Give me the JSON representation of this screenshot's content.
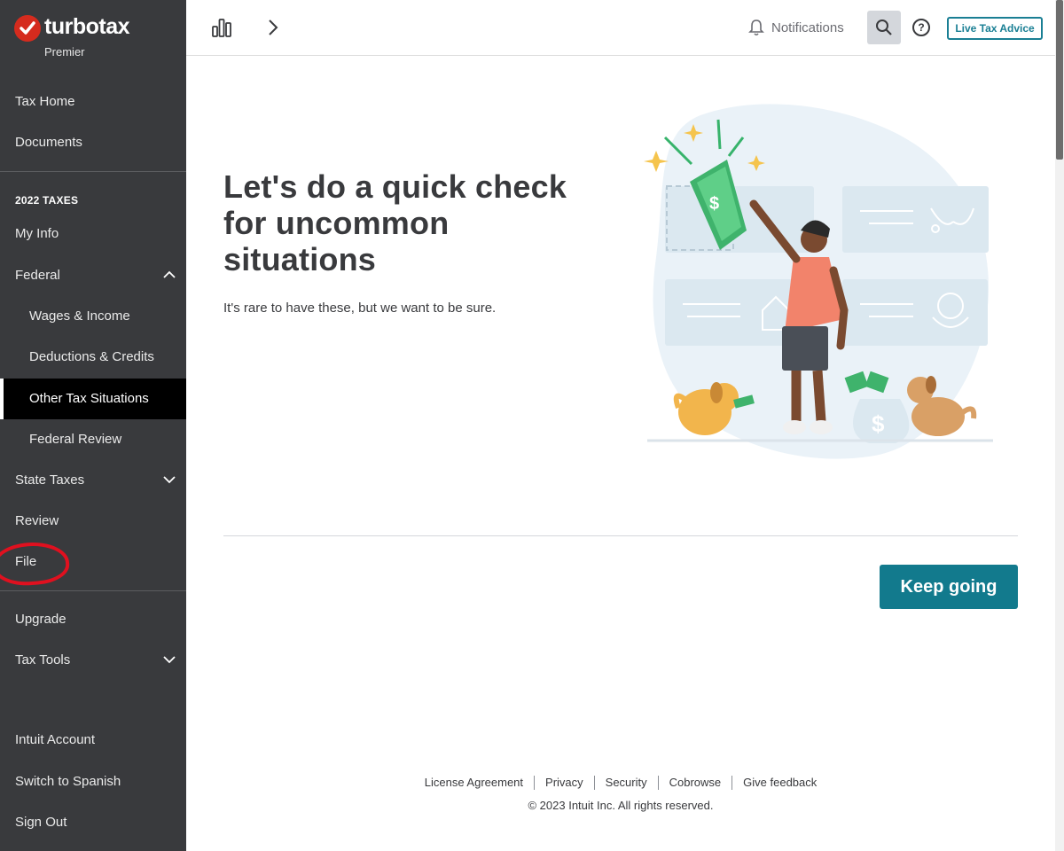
{
  "brand": {
    "name": "turbotax",
    "edition": "Premier"
  },
  "sidebar": {
    "top_items": [
      {
        "label": "Tax Home"
      },
      {
        "label": "Documents"
      }
    ],
    "section_label": "2022 TAXES",
    "items": [
      {
        "label": "My Info"
      },
      {
        "label": "Federal"
      },
      {
        "label": "Wages & Income"
      },
      {
        "label": "Deductions & Credits"
      },
      {
        "label": "Other Tax Situations"
      },
      {
        "label": "Federal Review"
      },
      {
        "label": "State Taxes"
      },
      {
        "label": "Review"
      },
      {
        "label": "File"
      }
    ],
    "extra_items": [
      {
        "label": "Upgrade"
      },
      {
        "label": "Tax Tools"
      }
    ],
    "bottom_items": [
      {
        "label": "Intuit Account"
      },
      {
        "label": "Switch to Spanish"
      },
      {
        "label": "Sign Out"
      }
    ]
  },
  "header": {
    "notifications_label": "Notifications",
    "help_label": "?",
    "live_advice_label": "Live Tax Advice"
  },
  "main": {
    "heading": "Let's do a quick check for uncommon situations",
    "subtext": "It's rare to have these, but we want to be sure.",
    "primary_button": "Keep going"
  },
  "footer": {
    "links": [
      "License Agreement",
      "Privacy",
      "Security",
      "Cobrowse",
      "Give feedback"
    ],
    "copyright": "© 2023 Intuit Inc. All rights reserved."
  },
  "colors": {
    "sidebar_bg": "#393a3d",
    "active_bg": "#000000",
    "primary_button": "#127a8d",
    "brand_red": "#d52b1e",
    "annotation": "#e0101f"
  }
}
